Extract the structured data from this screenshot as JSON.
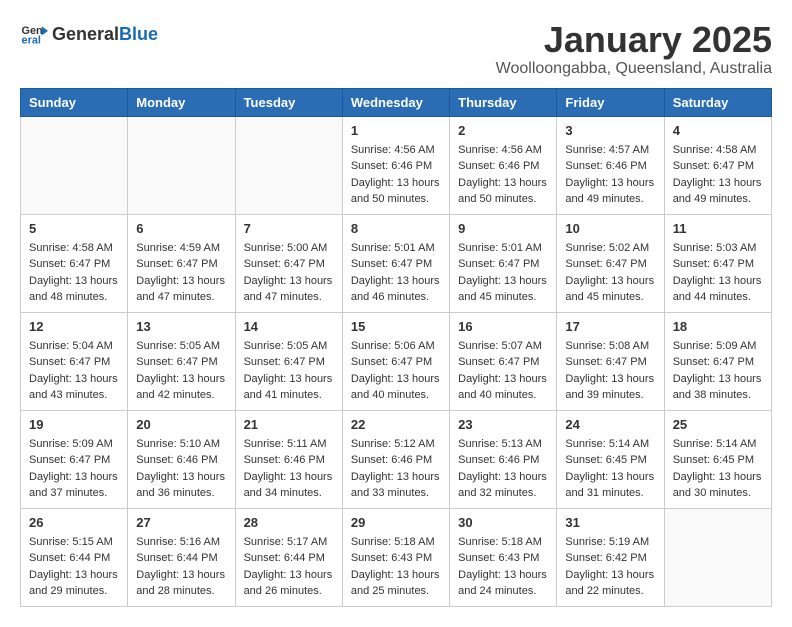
{
  "header": {
    "logo_general": "General",
    "logo_blue": "Blue",
    "month": "January 2025",
    "location": "Woolloongabba, Queensland, Australia"
  },
  "weekdays": [
    "Sunday",
    "Monday",
    "Tuesday",
    "Wednesday",
    "Thursday",
    "Friday",
    "Saturday"
  ],
  "weeks": [
    [
      {
        "day": "",
        "info": ""
      },
      {
        "day": "",
        "info": ""
      },
      {
        "day": "",
        "info": ""
      },
      {
        "day": "1",
        "info": "Sunrise: 4:56 AM\nSunset: 6:46 PM\nDaylight: 13 hours\nand 50 minutes."
      },
      {
        "day": "2",
        "info": "Sunrise: 4:56 AM\nSunset: 6:46 PM\nDaylight: 13 hours\nand 50 minutes."
      },
      {
        "day": "3",
        "info": "Sunrise: 4:57 AM\nSunset: 6:46 PM\nDaylight: 13 hours\nand 49 minutes."
      },
      {
        "day": "4",
        "info": "Sunrise: 4:58 AM\nSunset: 6:47 PM\nDaylight: 13 hours\nand 49 minutes."
      }
    ],
    [
      {
        "day": "5",
        "info": "Sunrise: 4:58 AM\nSunset: 6:47 PM\nDaylight: 13 hours\nand 48 minutes."
      },
      {
        "day": "6",
        "info": "Sunrise: 4:59 AM\nSunset: 6:47 PM\nDaylight: 13 hours\nand 47 minutes."
      },
      {
        "day": "7",
        "info": "Sunrise: 5:00 AM\nSunset: 6:47 PM\nDaylight: 13 hours\nand 47 minutes."
      },
      {
        "day": "8",
        "info": "Sunrise: 5:01 AM\nSunset: 6:47 PM\nDaylight: 13 hours\nand 46 minutes."
      },
      {
        "day": "9",
        "info": "Sunrise: 5:01 AM\nSunset: 6:47 PM\nDaylight: 13 hours\nand 45 minutes."
      },
      {
        "day": "10",
        "info": "Sunrise: 5:02 AM\nSunset: 6:47 PM\nDaylight: 13 hours\nand 45 minutes."
      },
      {
        "day": "11",
        "info": "Sunrise: 5:03 AM\nSunset: 6:47 PM\nDaylight: 13 hours\nand 44 minutes."
      }
    ],
    [
      {
        "day": "12",
        "info": "Sunrise: 5:04 AM\nSunset: 6:47 PM\nDaylight: 13 hours\nand 43 minutes."
      },
      {
        "day": "13",
        "info": "Sunrise: 5:05 AM\nSunset: 6:47 PM\nDaylight: 13 hours\nand 42 minutes."
      },
      {
        "day": "14",
        "info": "Sunrise: 5:05 AM\nSunset: 6:47 PM\nDaylight: 13 hours\nand 41 minutes."
      },
      {
        "day": "15",
        "info": "Sunrise: 5:06 AM\nSunset: 6:47 PM\nDaylight: 13 hours\nand 40 minutes."
      },
      {
        "day": "16",
        "info": "Sunrise: 5:07 AM\nSunset: 6:47 PM\nDaylight: 13 hours\nand 40 minutes."
      },
      {
        "day": "17",
        "info": "Sunrise: 5:08 AM\nSunset: 6:47 PM\nDaylight: 13 hours\nand 39 minutes."
      },
      {
        "day": "18",
        "info": "Sunrise: 5:09 AM\nSunset: 6:47 PM\nDaylight: 13 hours\nand 38 minutes."
      }
    ],
    [
      {
        "day": "19",
        "info": "Sunrise: 5:09 AM\nSunset: 6:47 PM\nDaylight: 13 hours\nand 37 minutes."
      },
      {
        "day": "20",
        "info": "Sunrise: 5:10 AM\nSunset: 6:46 PM\nDaylight: 13 hours\nand 36 minutes."
      },
      {
        "day": "21",
        "info": "Sunrise: 5:11 AM\nSunset: 6:46 PM\nDaylight: 13 hours\nand 34 minutes."
      },
      {
        "day": "22",
        "info": "Sunrise: 5:12 AM\nSunset: 6:46 PM\nDaylight: 13 hours\nand 33 minutes."
      },
      {
        "day": "23",
        "info": "Sunrise: 5:13 AM\nSunset: 6:46 PM\nDaylight: 13 hours\nand 32 minutes."
      },
      {
        "day": "24",
        "info": "Sunrise: 5:14 AM\nSunset: 6:45 PM\nDaylight: 13 hours\nand 31 minutes."
      },
      {
        "day": "25",
        "info": "Sunrise: 5:14 AM\nSunset: 6:45 PM\nDaylight: 13 hours\nand 30 minutes."
      }
    ],
    [
      {
        "day": "26",
        "info": "Sunrise: 5:15 AM\nSunset: 6:44 PM\nDaylight: 13 hours\nand 29 minutes."
      },
      {
        "day": "27",
        "info": "Sunrise: 5:16 AM\nSunset: 6:44 PM\nDaylight: 13 hours\nand 28 minutes."
      },
      {
        "day": "28",
        "info": "Sunrise: 5:17 AM\nSunset: 6:44 PM\nDaylight: 13 hours\nand 26 minutes."
      },
      {
        "day": "29",
        "info": "Sunrise: 5:18 AM\nSunset: 6:43 PM\nDaylight: 13 hours\nand 25 minutes."
      },
      {
        "day": "30",
        "info": "Sunrise: 5:18 AM\nSunset: 6:43 PM\nDaylight: 13 hours\nand 24 minutes."
      },
      {
        "day": "31",
        "info": "Sunrise: 5:19 AM\nSunset: 6:42 PM\nDaylight: 13 hours\nand 22 minutes."
      },
      {
        "day": "",
        "info": ""
      }
    ]
  ]
}
